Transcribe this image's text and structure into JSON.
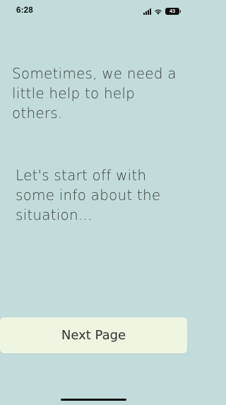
{
  "status_bar": {
    "time": "6:28",
    "battery_level": "43",
    "icons": [
      "cellular-signal-icon",
      "wifi-icon",
      "battery-icon"
    ]
  },
  "content": {
    "heading": "Sometimes, we need a little help to help others.",
    "subheading": "Let's start off with some info about the situation..."
  },
  "actions": {
    "next_label": "Next Page"
  },
  "colors": {
    "background": "#c1dcdb",
    "button_background": "#eef5e1",
    "text": "#3c3f3f"
  }
}
